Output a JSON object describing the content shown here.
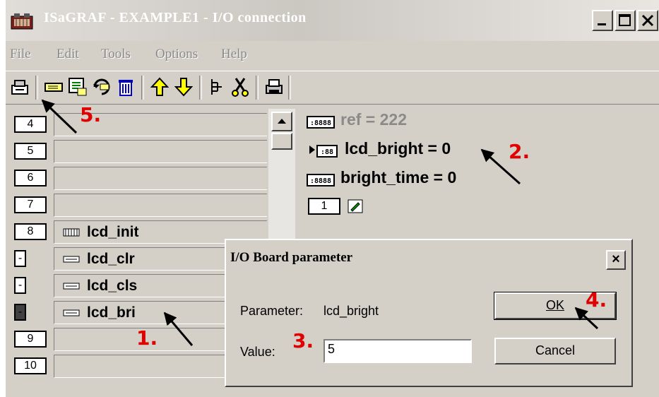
{
  "window": {
    "title": "ISaGRAF - EXAMPLE1 - I/O connection"
  },
  "menu": [
    "File",
    "Edit",
    "Tools",
    "Options",
    "Help"
  ],
  "list": {
    "rows": [
      {
        "num": "4",
        "label": ""
      },
      {
        "num": "5",
        "label": ""
      },
      {
        "num": "6",
        "label": ""
      },
      {
        "num": "7",
        "label": ""
      },
      {
        "num": "8",
        "label": "lcd_init"
      },
      {
        "num": "-",
        "label": "lcd_clr"
      },
      {
        "num": "-",
        "label": "lcd_cls"
      },
      {
        "num": "-",
        "label": "lcd_bri"
      },
      {
        "num": "9",
        "label": ""
      },
      {
        "num": "10",
        "label": ""
      }
    ]
  },
  "vars": {
    "ref": "ref = 222",
    "lcd_bright": "lcd_bright = 0",
    "bright_time": "bright_time = 0",
    "index": "1"
  },
  "dialog": {
    "title": "I/O Board parameter",
    "close": "×",
    "param_label": "Parameter:",
    "param_value": "lcd_bright",
    "value_label": "Value:",
    "value": "5",
    "ok": "OK",
    "cancel": "Cancel"
  },
  "annotations": {
    "a1": "1.",
    "a2": "2.",
    "a3": "3.",
    "a4": "4.",
    "a5": "5."
  },
  "colors": {
    "annotation": "#e00000",
    "chrome": "#d4d0c8"
  }
}
